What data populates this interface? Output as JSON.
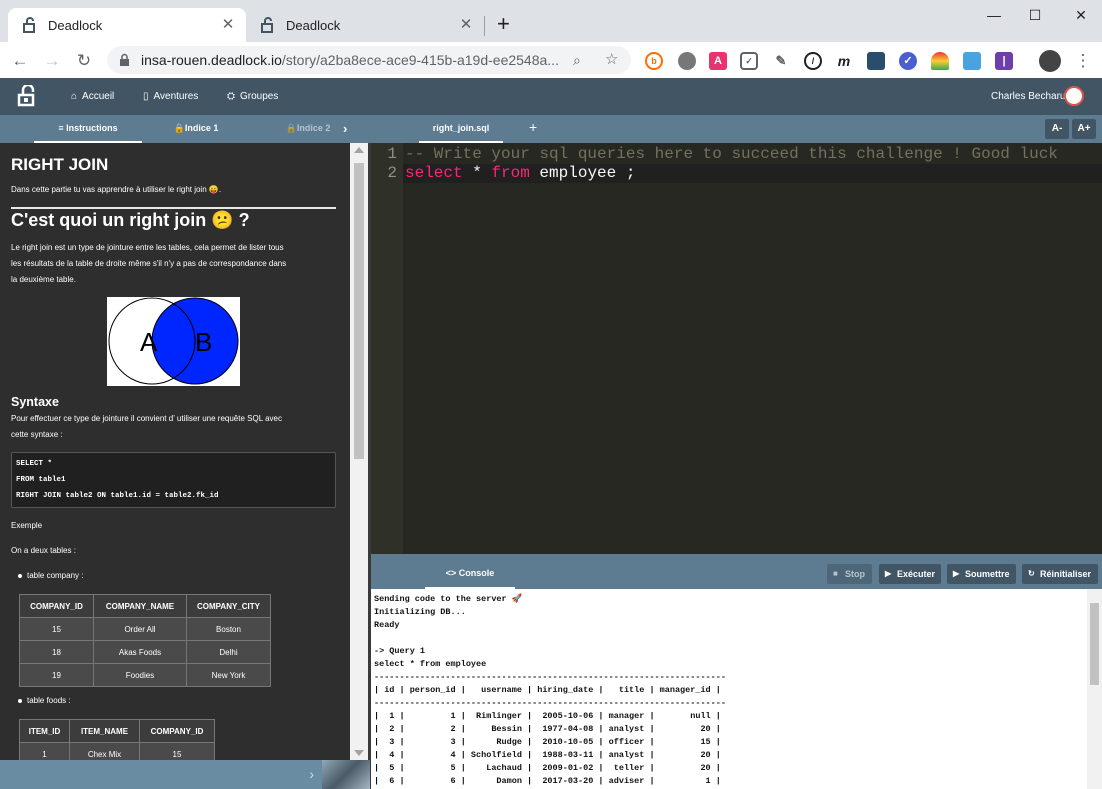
{
  "browser": {
    "tabs": [
      {
        "title": "Deadlock",
        "active": true
      },
      {
        "title": "Deadlock",
        "active": false
      }
    ],
    "url_domain": "insa-rouen.deadlock.io",
    "url_path": "/story/a2ba8ece-ace9-415b-a19d-ee2548a...",
    "new_tab": "+"
  },
  "nav": {
    "items": [
      {
        "label": "Accueil",
        "icon": "home-icon"
      },
      {
        "label": "Aventures",
        "icon": "book-icon"
      },
      {
        "label": "Groupes",
        "icon": "group-icon"
      }
    ],
    "user": "Charles Becharu"
  },
  "subtabs": {
    "instructions": "Instructions",
    "hint1": "Indice 1",
    "hint2": "Indice 2",
    "file": "right_join.sql",
    "font_minus": "A-",
    "font_plus": "A+"
  },
  "instructions": {
    "title": "RIGHT JOIN",
    "intro": "Dans cette partie tu vas apprendre à utiliser le right join 😛.",
    "h2": "C'est quoi un right join 😕 ?",
    "desc1": "Le right join est un type de jointure entre les tables, cela permet de lister tous",
    "desc2": "les résultats de la table de droite même s'il n'y a pas de correspondance dans",
    "desc3": "la deuxième table.",
    "venn_a": "A",
    "venn_b": "B",
    "syntax_title": "Syntaxe",
    "syntax_desc1": "Pour effectuer ce type de jointure il convient d’  utiliser une requête SQL avec",
    "syntax_desc2": "cette syntaxe :",
    "code": [
      "SELECT *",
      "FROM table1",
      "RIGHT JOIN table2 ON table1.id = table2.fk_id"
    ],
    "example": "Exemple",
    "two_tables": "On a deux tables :",
    "bullet_company": "table company :",
    "company_headers": [
      "COMPANY_ID",
      "COMPANY_NAME",
      "COMPANY_CITY"
    ],
    "company_rows": [
      [
        "15",
        "Order All",
        "Boston"
      ],
      [
        "18",
        "Akas Foods",
        "Delhi"
      ],
      [
        "19",
        "Foodies",
        "New York"
      ]
    ],
    "bullet_foods": "table foods :",
    "foods_headers": [
      "ITEM_ID",
      "ITEM_NAME",
      "COMPANY_ID"
    ],
    "foods_rows": [
      [
        "1",
        "Chex Mix",
        "15"
      ]
    ]
  },
  "editor": {
    "lines": [
      {
        "num": "1",
        "text": "-- Write your sql queries here to succeed this challenge ! Good luck"
      },
      {
        "num": "2",
        "kw1": "select",
        "star": " * ",
        "kw2": "from",
        "rest": " employee ;"
      }
    ]
  },
  "console": {
    "tab": "<> Console",
    "buttons": {
      "stop": "Stop",
      "run": "Exécuter",
      "submit": "Soumettre",
      "reset": "Réinitialiser"
    },
    "lines": [
      "Sending code to the server 🚀",
      "Initializing DB...",
      "Ready",
      "",
      "-> Query 1",
      "select * from employee",
      "---------------------------------------------------------------------",
      "| id | person_id |   username | hiring_date |   title | manager_id |",
      "---------------------------------------------------------------------",
      "|  1 |         1 |  Rimlinger |  2005-10-06 | manager |       null |",
      "|  2 |         2 |     Bessin |  1977-04-08 | analyst |         20 |",
      "|  3 |         3 |      Rudge |  2010-10-05 | officer |         15 |",
      "|  4 |         4 | Scholfield |  1988-03-11 | analyst |         20 |",
      "|  5 |         5 |    Lachaud |  2009-01-02 |  teller |         20 |",
      "|  6 |         6 |      Damon |  2017-03-20 | adviser |          1 |"
    ]
  }
}
